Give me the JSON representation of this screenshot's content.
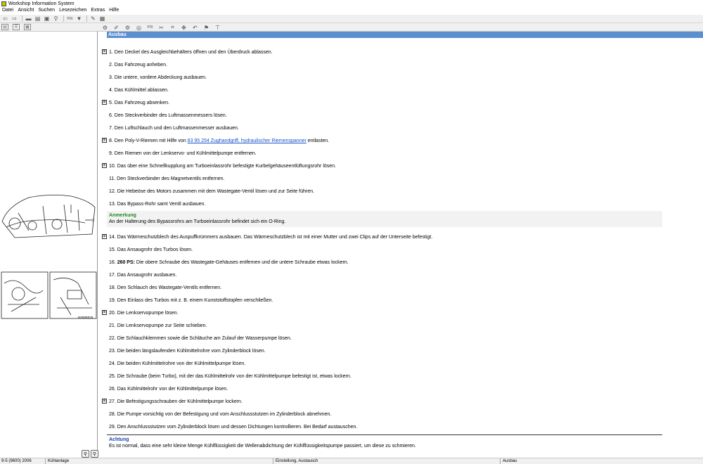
{
  "window": {
    "title": "Workshop Information System"
  },
  "menu": [
    "Datei",
    "Ansicht",
    "Suchen",
    "Lesezeichen",
    "Extras",
    "Hilfe"
  ],
  "toolbar1": [
    {
      "icon": "back-arrow-icon",
      "glyph": "⇦"
    },
    {
      "icon": "forward-arrow-icon",
      "glyph": "⇨"
    },
    {
      "icon": "car-icon",
      "glyph": "▬"
    },
    {
      "icon": "print-icon",
      "glyph": "▤"
    },
    {
      "icon": "toolbox-icon",
      "glyph": "▣"
    },
    {
      "icon": "magnify-icon",
      "glyph": "⚲"
    },
    {
      "icon": "pdi-icon",
      "glyph": "PDI"
    },
    {
      "icon": "funnel-icon",
      "glyph": "▼"
    },
    {
      "icon": "pencil-icon",
      "glyph": "✎"
    },
    {
      "icon": "bookmark-icon",
      "glyph": "▦"
    }
  ],
  "toolbar2": [
    {
      "icon": "engine-icon",
      "glyph": "⚙"
    },
    {
      "icon": "spark-plug-icon",
      "glyph": "✐"
    },
    {
      "icon": "gears-icon",
      "glyph": "⚙"
    },
    {
      "icon": "brake-icon",
      "glyph": "◎"
    },
    {
      "icon": "pdi-icon",
      "glyph": "PDI"
    },
    {
      "icon": "tools-icon",
      "glyph": "✂"
    },
    {
      "icon": "wiring-icon",
      "glyph": "⌗"
    },
    {
      "icon": "move-icon",
      "glyph": "✥"
    },
    {
      "icon": "undo-icon",
      "glyph": "↶"
    },
    {
      "icon": "flag-icon",
      "glyph": "⚑"
    },
    {
      "icon": "hoist-icon",
      "glyph": "⊤"
    }
  ],
  "content": {
    "section_title": "Ausbau",
    "steps": [
      {
        "num": "1.",
        "text": "Den Deckel des Ausgleichbehälters öffnen und den Überdruck ablassen.",
        "icon": true
      },
      {
        "num": "2.",
        "text": "Das Fahrzeug anheben.",
        "icon": false
      },
      {
        "num": "3.",
        "text": "Die untere, vordere Abdeckung ausbauen.",
        "icon": false
      },
      {
        "num": "4.",
        "text": "Das Kühlmittel ablassen.",
        "icon": false
      },
      {
        "num": "5.",
        "text": "Das Fahrzeug absenken.",
        "icon": true
      },
      {
        "num": "6.",
        "text": "Den Steckverbinder des Luftmassenmessers lösen.",
        "icon": false
      },
      {
        "num": "7.",
        "text": "Den Luftschlauch und den Luftmassenmesser ausbauen.",
        "icon": false
      },
      {
        "num": "8.",
        "text_before": "Den Poly-V-Riemen mit Hilfe von ",
        "link": "83 95 254 Zughandgriff, hydraulischer Riemenspanner",
        "text_after": " entlasten.",
        "icon": true
      },
      {
        "num": "9.",
        "text": "Den Riemen von der Lenkservo- und Kühlmittelpumpe entfernen.",
        "icon": false
      },
      {
        "num": "10.",
        "text": "Das über eine Schnellkupplung am Turboeinlassrohr befestigte Kurbelgehäuseentlüftungsrohr lösen.",
        "icon": true
      },
      {
        "num": "11.",
        "text": "Den Steckverbinder des Magnetventils entfernen.",
        "icon": false
      },
      {
        "num": "12.",
        "text": "Die Hebeöse des Motors zusammen mit dem Wastegate-Ventil lösen und zur Seite führen.",
        "icon": false
      },
      {
        "num": "13.",
        "text": "Das Bypass-Rohr samt Ventil ausbauen.",
        "icon": false
      }
    ],
    "note": {
      "title": "Anmerkung",
      "text": "An der Halterung des Bypassrohrs am Turboeinlassrohr befindet sich ein O-Ring.",
      "title_color": "#1e8a1e"
    },
    "steps2": [
      {
        "num": "14.",
        "text": "Das Wärmeschutzblech des Auspuffkrümmers ausbauen. Das Wärmeschutzblech ist mit einer Mutter und zwei Clips auf der Unterseite befestigt.",
        "icon": true
      },
      {
        "num": "15.",
        "text": "Das Ansaugrohr des Turbos lösen.",
        "icon": false
      },
      {
        "num": "16.",
        "bold": "260 PS:",
        "text": " Die obere Schraube des Wastegate-Gehäuses entfernen und die untere Schraube etwas lockern.",
        "icon": false
      },
      {
        "num": "17.",
        "text": "Das Ansaugrohr ausbauen.",
        "icon": false
      },
      {
        "num": "18.",
        "text": "Den Schlauch des Wastegate-Ventils entfernen.",
        "icon": false
      },
      {
        "num": "19.",
        "text": "Den Einlass des Turbos mit z. B. einem Kunststoffstopfen verschließen.",
        "icon": false
      },
      {
        "num": "20.",
        "text": "Die Lenkservopumpe lösen.",
        "icon": true
      },
      {
        "num": "21.",
        "text": "Die Lenkservopumpe zur Seite schieben.",
        "icon": false
      },
      {
        "num": "22.",
        "text": "Die Schlauchklemmen sowie die Schläuche am Zulauf der Wasserpumpe lösen.",
        "icon": false
      },
      {
        "num": "23.",
        "text": "Die beiden längslaufenden Kühlmittelrohre vom Zylinderblock lösen.",
        "icon": false
      },
      {
        "num": "24.",
        "text": "Die beiden Kühlmittelrohre von der Kühlmittelpumpe lösen.",
        "icon": false
      },
      {
        "num": "25.",
        "text": "Die Schraube (beim Turbo), mit der das Kühlmittelrohr von der Kühlmittelpumpe befestigt ist, etwas lockern.",
        "icon": false
      },
      {
        "num": "26.",
        "text": "Das Kühlmittelrohr von der Kühlmittelpumpe lösen.",
        "icon": false
      },
      {
        "num": "27.",
        "text": "Die Befestigungsschrauben der Kühlmittelpumpe lockern.",
        "icon": true
      },
      {
        "num": "28.",
        "text": "Die Pumpe vorsichtig von der Befestigung und vom Anschlussstutzen im Zylinderblock abnehmen.",
        "icon": false
      },
      {
        "num": "29.",
        "text": "Den Anschlussstutzen vom Zylinderblock lösen und dessen Dichtungen kontrollieren. Bei Bedarf austauschen.",
        "icon": false
      }
    ],
    "warning": {
      "title": "Achtung",
      "text": "Es ist normal, dass eine sehr kleine Menge Kühlflüssigkeit die Wellenabdichtung der Kühlflüssigkeitspumpe passiert, um diese zu schmieren.",
      "title_color": "#1a3fb0"
    }
  },
  "illustration": {
    "label_3": "3",
    "code": "B280R026"
  },
  "zoom": {
    "in": "+",
    "out": "−"
  },
  "status": {
    "model": "9-5 (9600) 2006",
    "system": "Kühlanlage",
    "operation": "Einstellung, Austausch",
    "section": "Ausbau"
  }
}
